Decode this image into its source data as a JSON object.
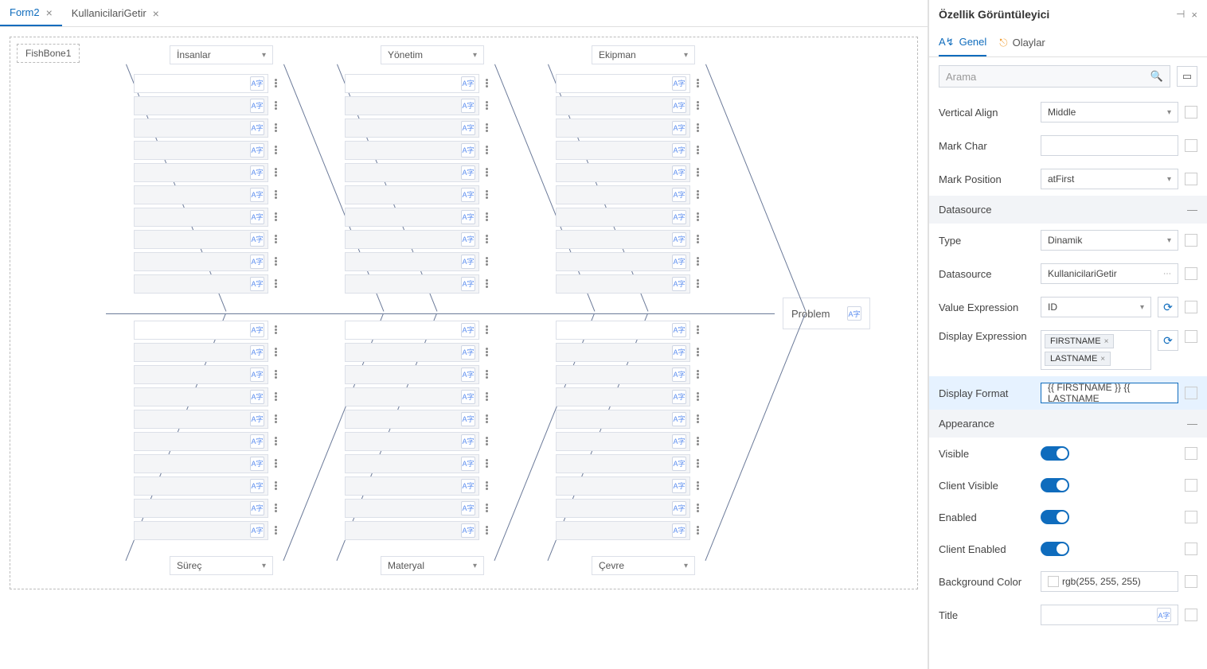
{
  "tabs": [
    {
      "label": "Form2",
      "active": true
    },
    {
      "label": "KullanicilariGetir",
      "active": false
    }
  ],
  "fishbone": {
    "elementLabel": "FishBone1",
    "head": "Problem",
    "topCategories": [
      "İnsanlar",
      "Yönetim",
      "Ekipman"
    ],
    "bottomCategories": [
      "Süreç",
      "Materyal",
      "Çevre"
    ]
  },
  "rightPanel": {
    "title": "Özellik Görüntüleyici",
    "tabs": {
      "general": "Genel",
      "events": "Olaylar"
    },
    "searchPlaceholder": "Arama",
    "props": {
      "verticalAlign": {
        "label": "Vertical Align",
        "value": "Middle"
      },
      "markChar": {
        "label": "Mark Char",
        "value": ""
      },
      "markPosition": {
        "label": "Mark Position",
        "value": "atFirst"
      },
      "datasourceSection": "Datasource",
      "type": {
        "label": "Type",
        "value": "Dinamik"
      },
      "datasource": {
        "label": "Datasource",
        "value": "KullanicilariGetir"
      },
      "valueExpression": {
        "label": "Value Expression",
        "value": "ID"
      },
      "displayExpression": {
        "label": "Display Expression",
        "tags": [
          "FIRSTNAME",
          "LASTNAME"
        ]
      },
      "displayFormat": {
        "label": "Display Format",
        "value": "{{ FIRSTNAME }} {{ LASTNAME"
      },
      "appearanceSection": "Appearance",
      "visible": {
        "label": "Visible"
      },
      "clientVisible": {
        "label": "Client Visible"
      },
      "enabled": {
        "label": "Enabled"
      },
      "clientEnabled": {
        "label": "Client Enabled"
      },
      "backgroundColor": {
        "label": "Background Color",
        "value": "rgb(255, 255, 255)"
      },
      "title": {
        "label": "Title",
        "value": ""
      }
    }
  }
}
